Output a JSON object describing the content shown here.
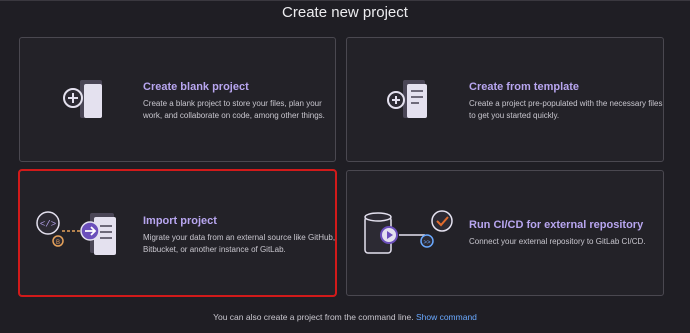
{
  "page": {
    "title": "Create new project"
  },
  "cards": [
    {
      "title": "Create blank project",
      "description": "Create a blank project to store your files, plan your work, and collaborate on code, among other things.",
      "icon": "blank-project-icon"
    },
    {
      "title": "Create from template",
      "description": "Create a project pre-populated with the necessary files to get you started quickly.",
      "icon": "template-project-icon"
    },
    {
      "title": "Import project",
      "description": "Migrate your data from an external source like GitHub, Bitbucket, or another instance of GitLab.",
      "icon": "import-project-icon",
      "highlighted": true
    },
    {
      "title": "Run CI/CD for external repository",
      "description": "Connect your external repository to GitLab CI/CD.",
      "icon": "cicd-external-repo-icon"
    }
  ],
  "footer": {
    "text": "You can also create a project from the command line.",
    "link_label": "Show command"
  },
  "colors": {
    "background": "#1f1e24",
    "card_border": "#4a4850",
    "title_accent": "#b8a6f0",
    "link": "#6aa9ff",
    "highlight": "#d11a1a"
  }
}
